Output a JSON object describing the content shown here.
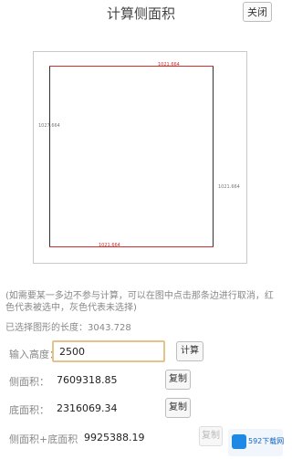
{
  "header": {
    "title": "计算侧面积",
    "close_label": "关闭"
  },
  "canvas": {
    "edges": {
      "top": "1021.664",
      "bottom": "1021.664",
      "left": "1027.664",
      "right": "1021.664"
    },
    "colors": {
      "selected": "#d32f2f",
      "unselected": "#777777"
    }
  },
  "hint": "(如需要某一多边不参与计算，可以在图中点击那条边进行取消，红色代表被选中，灰色代表未选择)",
  "selected_length": "已选择图形的长度：3043.728",
  "form": {
    "height_label": "输入高度：",
    "height_value": "2500",
    "calc_label": "计算"
  },
  "results": {
    "lateral_label": "侧面积：",
    "lateral_value": "7609318.85",
    "base_label": "底面积：",
    "base_value": "2316069.34",
    "total_label": "侧面积+底面积",
    "total_value": "9925388.19",
    "copy_label": "复制"
  },
  "watermark": {
    "text": "592下载网"
  }
}
